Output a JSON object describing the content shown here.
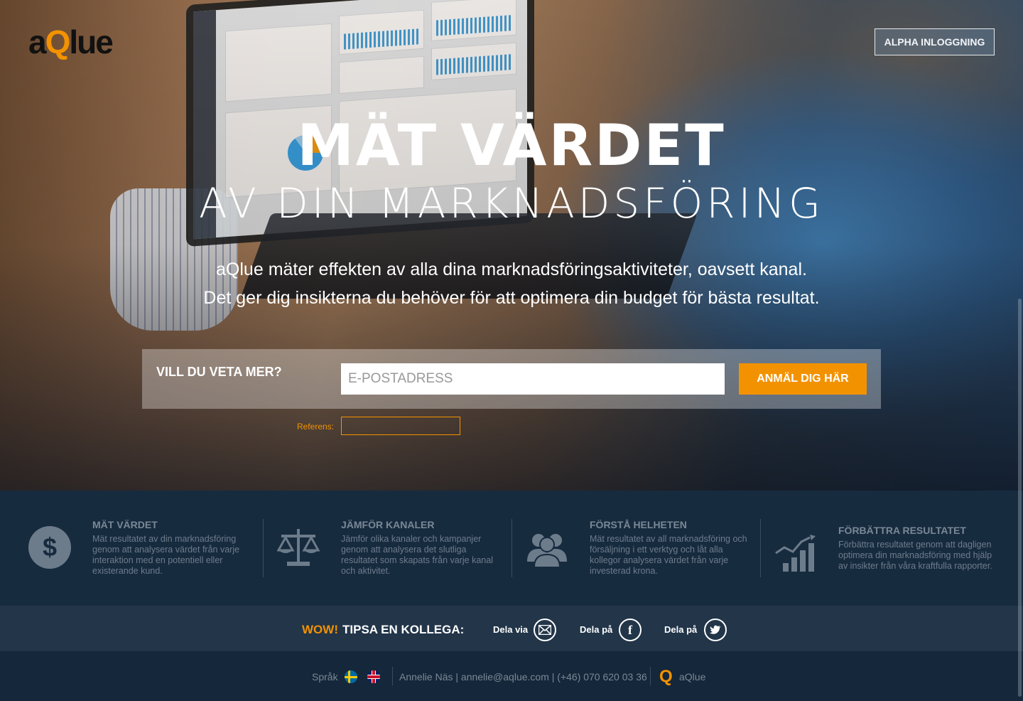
{
  "header": {
    "logo_prefix": "a",
    "logo_q": "Q",
    "logo_suffix": "lue",
    "login_label": "ALPHA INLOGGNING"
  },
  "hero": {
    "title": "MÄT VÄRDET",
    "subtitle": "AV DIN MARKNADSFÖRING",
    "lead_1": "aQlue mäter effekten av alla dina marknadsföringsaktiviteter, oavsett kanal.",
    "lead_2": "Det ger dig insikterna du behöver för att optimera din budget för bästa resultat."
  },
  "signup": {
    "question": "VILL DU VETA MER?",
    "email_placeholder": "E-POSTADRESS",
    "cta_label": "ANMÄL DIG HÄR",
    "referens_label": "Referens:"
  },
  "features": [
    {
      "icon": "dollar-icon",
      "title": "MÄT VÄRDET",
      "text": "Mät resultatet av din marknadsföring genom att analysera värdet från varje interaktion med en potentiell eller existerande kund."
    },
    {
      "icon": "scales-icon",
      "title": "JÄMFÖR KANALER",
      "text": "Jämför olika kanaler och kampanjer genom att analysera det slutliga resultatet som skapats från varje kanal och aktivitet."
    },
    {
      "icon": "people-icon",
      "title": "FÖRSTÅ HELHETEN",
      "text": "Mät resultatet av all marknadsföring och försäljning i ett verktyg och låt alla kollegor analysera värdet från varje investerad krona."
    },
    {
      "icon": "growth-chart-icon",
      "title": "FÖRBÄTTRA RESULTATET",
      "text": "Förbättra resultatet genom att dagligen optimera din marknadsföring med hjälp av insikter från våra kraftfulla rapporter."
    }
  ],
  "share": {
    "wow": "WOW!",
    "tip": "TIPSA EN KOLLEGA:",
    "email_label": "Dela via",
    "facebook_label": "Dela på",
    "twitter_label": "Dela på"
  },
  "footer": {
    "language_label": "Språk",
    "contact": "Annelie Näs | annelie@aqlue.com | (+46) 070 620 03 36",
    "brand": "aQlue"
  },
  "colors": {
    "accent": "#f39200",
    "dark_bg": "#15273a"
  }
}
